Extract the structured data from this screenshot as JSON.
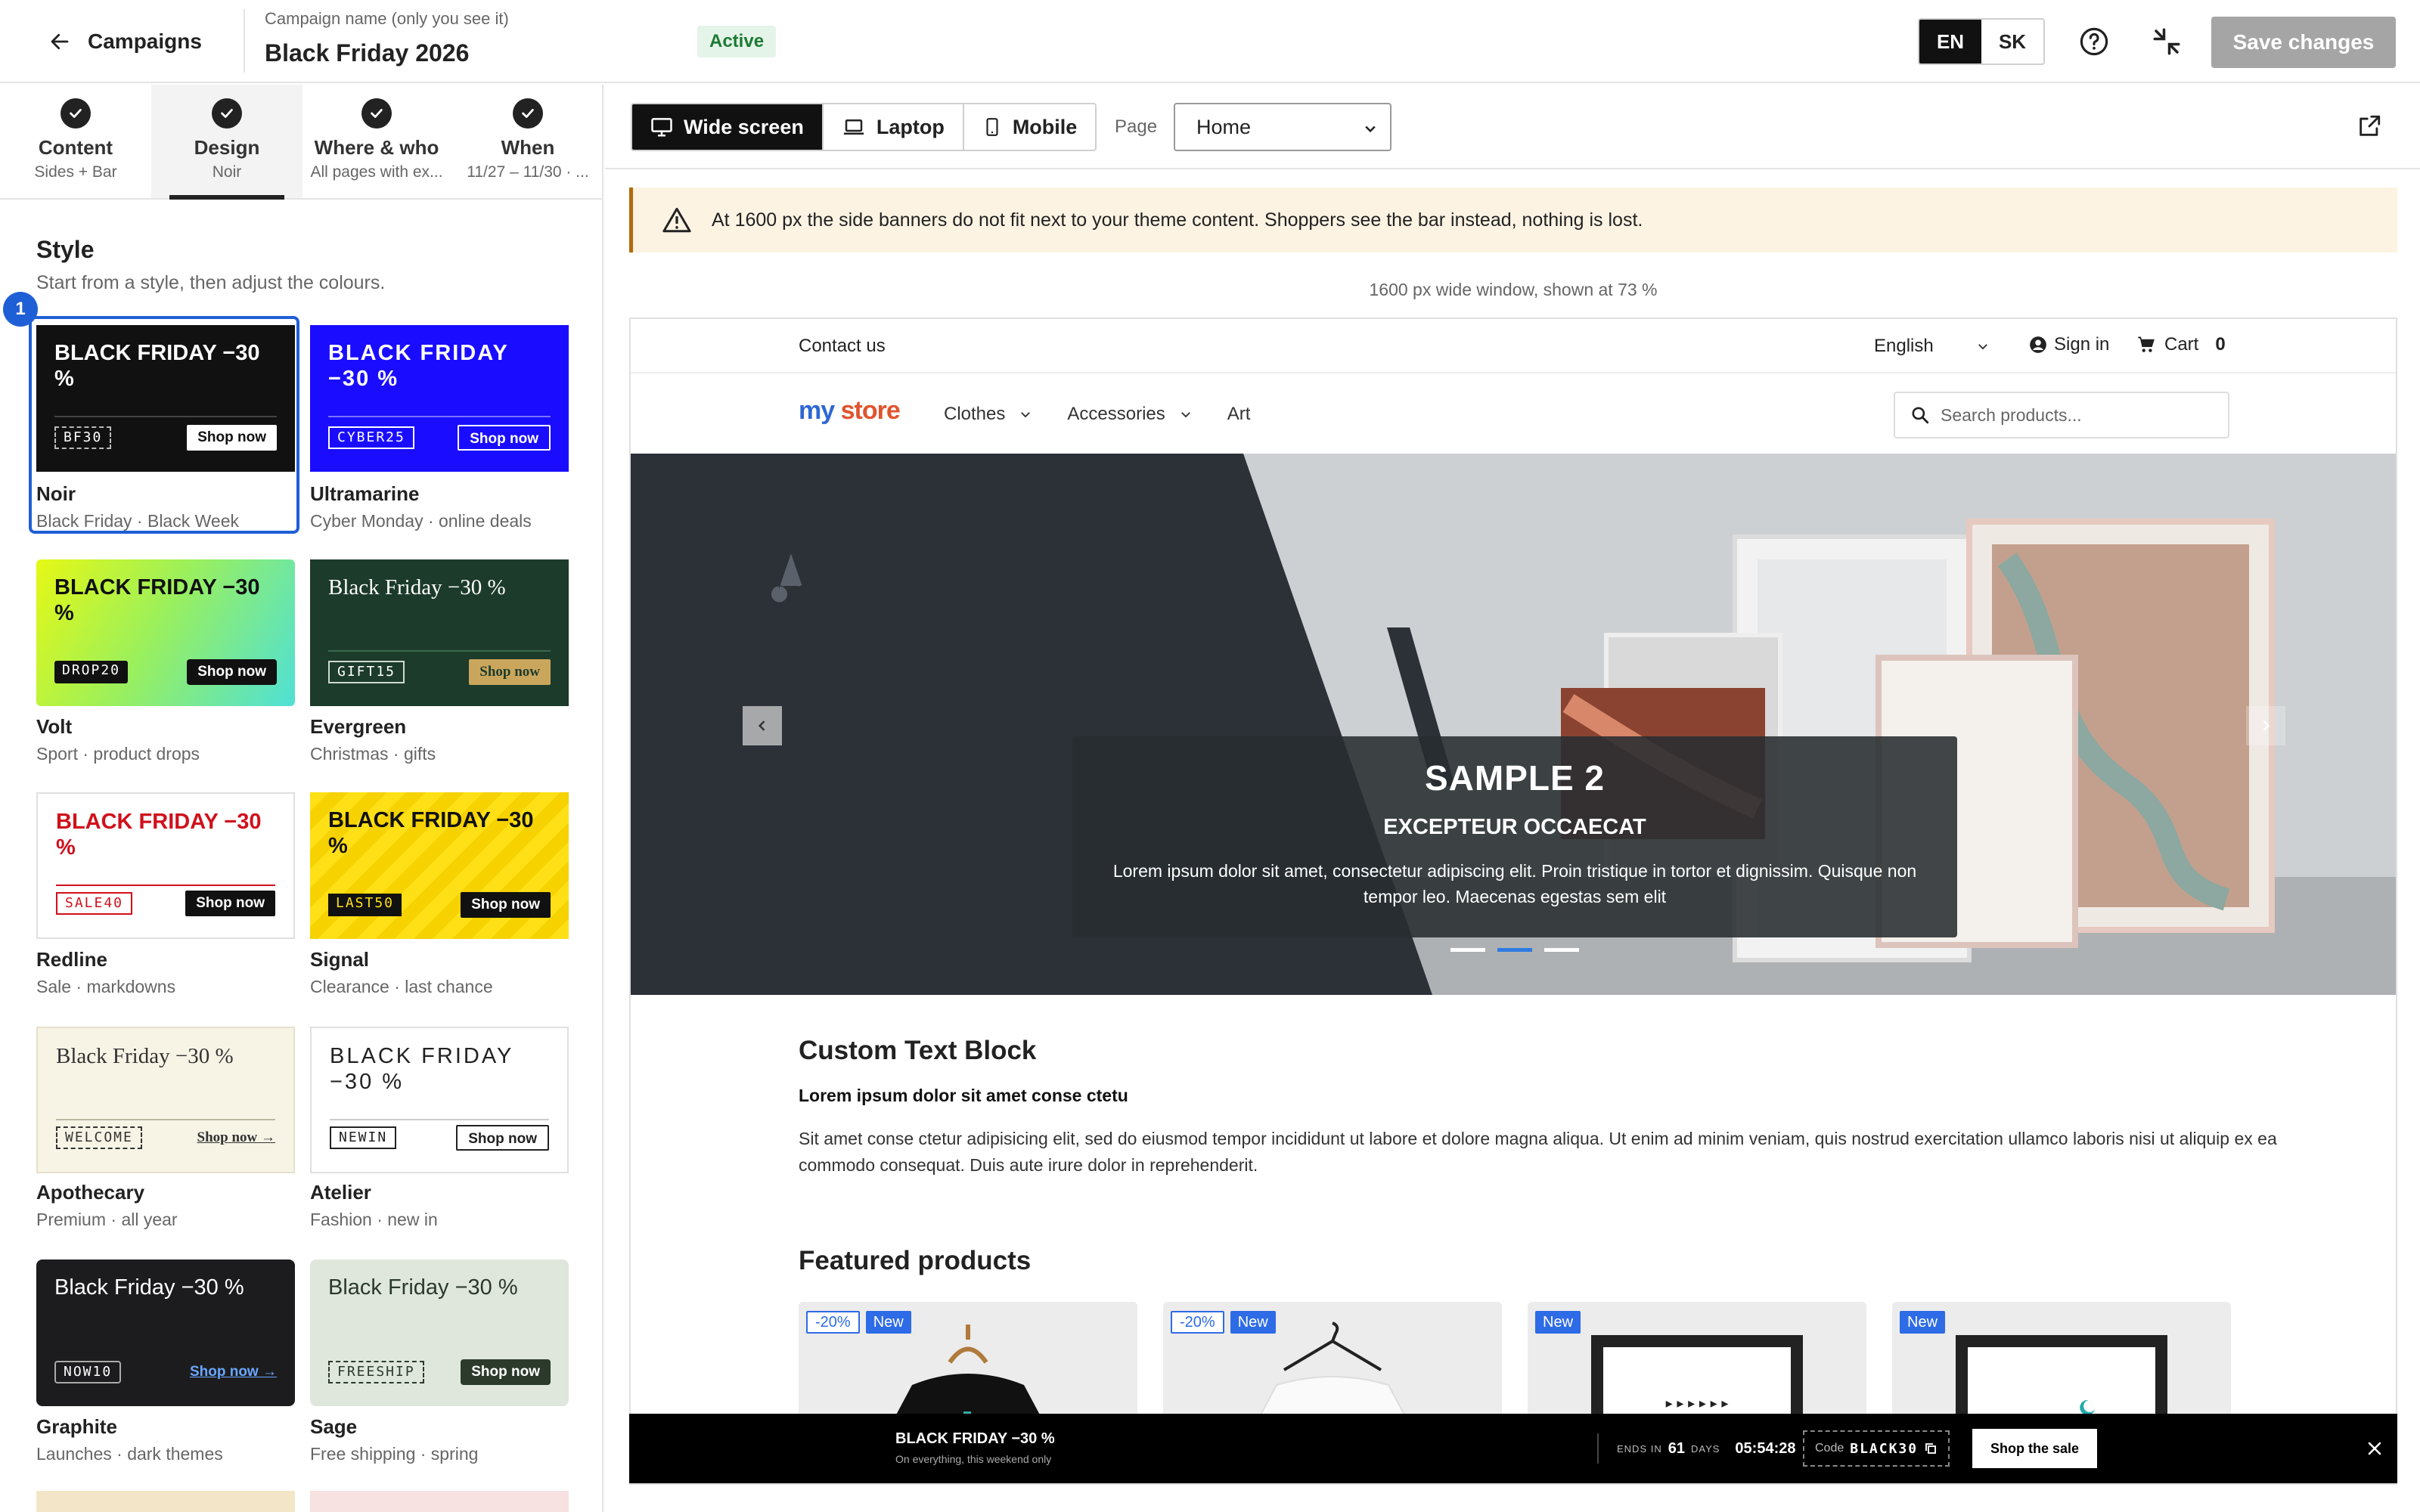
{
  "header": {
    "back_label": "Campaigns",
    "campaign_name_label": "Campaign name (only you see it)",
    "campaign_name": "Black Friday 2026",
    "status": "Active",
    "languages": [
      "EN",
      "SK"
    ],
    "active_language": "EN",
    "save_label": "Save changes"
  },
  "steps": [
    {
      "title": "Content",
      "sub": "Sides + Bar"
    },
    {
      "title": "Design",
      "sub": "Noir"
    },
    {
      "title": "Where & who",
      "sub": "All pages with ex..."
    },
    {
      "title": "When",
      "sub": "11/27 – 11/30 · ..."
    }
  ],
  "active_step": "Design",
  "style_panel": {
    "title": "Style",
    "subtitle": "Start from a style, then adjust the colours.",
    "selected_index_badge": "1",
    "cards": [
      {
        "name": "Noir",
        "tagline": "Black Friday · Black Week",
        "headline": "BLACK FRIDAY −30 %",
        "code": "BF30",
        "button": "Shop now",
        "bg": "#111111",
        "fg": "#ffffff"
      },
      {
        "name": "Ultramarine",
        "tagline": "Cyber Monday · online deals",
        "headline": "BLACK FRIDAY −30 %",
        "code": "CYBER25",
        "button": "Shop now",
        "bg": "#1a0dff",
        "fg": "#ffffff"
      },
      {
        "name": "Volt",
        "tagline": "Sport · product drops",
        "headline": "BLACK FRIDAY −30 %",
        "code": "DROP20",
        "button": "Shop now",
        "bg": "#c9f531",
        "fg": "#111111"
      },
      {
        "name": "Evergreen",
        "tagline": "Christmas · gifts",
        "headline": "Black Friday −30 %",
        "code": "GIFT15",
        "button": "Shop now",
        "bg": "#1c3b2b",
        "fg": "#ffffff"
      },
      {
        "name": "Redline",
        "tagline": "Sale · markdowns",
        "headline": "BLACK FRIDAY −30 %",
        "code": "SALE40",
        "button": "Shop now",
        "bg": "#ffffff",
        "fg": "#d0101b"
      },
      {
        "name": "Signal",
        "tagline": "Clearance · last chance",
        "headline": "BLACK FRIDAY −30 %",
        "code": "LAST50",
        "button": "Shop now",
        "bg": "#ffe016",
        "fg": "#111111"
      },
      {
        "name": "Apothecary",
        "tagline": "Premium · all year",
        "headline": "Black Friday −30 %",
        "code": "WELCOME",
        "button": "Shop now →",
        "bg": "#f7f4e6",
        "fg": "#333333"
      },
      {
        "name": "Atelier",
        "tagline": "Fashion · new in",
        "headline": "BLACK FRIDAY −30 %",
        "code": "NEWIN",
        "button": "Shop now",
        "bg": "#ffffff",
        "fg": "#222222"
      },
      {
        "name": "Graphite",
        "tagline": "Launches · dark themes",
        "headline": "Black Friday −30 %",
        "code": "NOW10",
        "button": "Shop now →",
        "bg": "#1c1c1e",
        "fg": "#ffffff"
      },
      {
        "name": "Sage",
        "tagline": "Free shipping · spring",
        "headline": "Black Friday −30 %",
        "code": "FREESHIP",
        "button": "Shop now",
        "bg": "#dfe7dc",
        "fg": "#2b3a2b"
      }
    ]
  },
  "preview": {
    "devices": [
      "Wide screen",
      "Laptop",
      "Mobile"
    ],
    "active_device": "Wide screen",
    "page_label": "Page",
    "page_value": "Home",
    "warning": "At 1600 px the side banners do not fit next to your theme content. Shoppers see the bar instead, nothing is lost.",
    "scale_note": "1600 px wide window, shown at 73 %"
  },
  "store": {
    "contact": "Contact us",
    "language": "English",
    "sign_in": "Sign in",
    "cart_label": "Cart",
    "cart_count": "0",
    "logo_first": "my",
    "logo_second": "store",
    "menu": [
      "Clothes",
      "Accessories",
      "Art"
    ],
    "search_placeholder": "Search products...",
    "hero_title": "SAMPLE 2",
    "hero_subtitle": "EXCEPTEUR OCCAECAT",
    "hero_text": "Lorem ipsum dolor sit amet, consectetur adipiscing elit. Proin tristique in tortor et dignissim. Quisque non tempor leo. Maecenas egestas sem elit",
    "block_title": "Custom Text Block",
    "block_bold": "Lorem ipsum dolor sit amet conse ctetu",
    "block_text": "Sit amet conse ctetur adipisicing elit, sed do eiusmod tempor incididunt ut labore et dolore magna aliqua. Ut enim ad minim veniam, quis nostrud exercitation ullamco laboris nisi ut aliquip ex ea commodo consequat. Duis aute irure dolor in reprehenderit.",
    "featured_title": "Featured products",
    "products": [
      {
        "discount": "-20%",
        "flag": "New"
      },
      {
        "discount": "-20%",
        "flag": "New"
      },
      {
        "discount": "",
        "flag": "New"
      },
      {
        "discount": "",
        "flag": "New"
      }
    ]
  },
  "promo_bar": {
    "title": "BLACK FRIDAY −30 %",
    "subtitle": "On everything, this weekend only",
    "ends_label": "ENDS IN",
    "days": "61",
    "days_label": "DAYS",
    "time": "05:54:28",
    "code_label": "Code",
    "code": "BLACK30",
    "button": "Shop the sale"
  },
  "colors": {
    "accent": "#1f5fd6",
    "save_disabled": "#a5a5a5",
    "warning_bg": "#fdf3e3",
    "active_badge_bg": "#e4f4e8"
  }
}
